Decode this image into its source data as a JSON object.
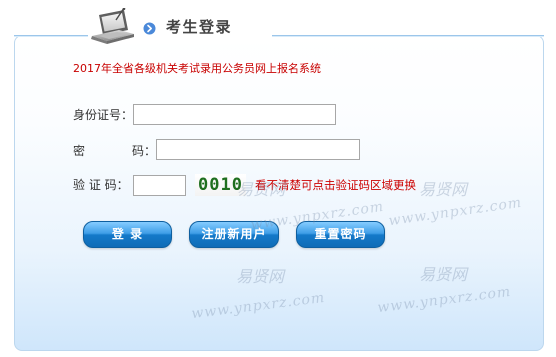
{
  "header": {
    "title": "考生登录",
    "icon": "laptop-icon",
    "marker_icon": "arrow-icon"
  },
  "notice": "2017年全省各级机关考试录用公务员网上报名系统",
  "form": {
    "id_label": "身份证号：",
    "password_label_left": "密",
    "password_label_right": "码：",
    "code_label": "验 证 码：",
    "id_value": "",
    "password_value": "",
    "code_value": "",
    "captcha": "0010",
    "captcha_hint": "看不清楚可点击验证码区域更换"
  },
  "buttons": {
    "login": "登 录",
    "register": "注册新用户",
    "reset": "重置密码"
  },
  "watermarks": {
    "logo": "易贤网",
    "url": "www.ynpxrz.com"
  },
  "colors": {
    "accent_blue": "#1479c9",
    "border_blue": "#bcd7ee",
    "alert_red": "#c80000",
    "captcha_green": "#2e7d32"
  }
}
